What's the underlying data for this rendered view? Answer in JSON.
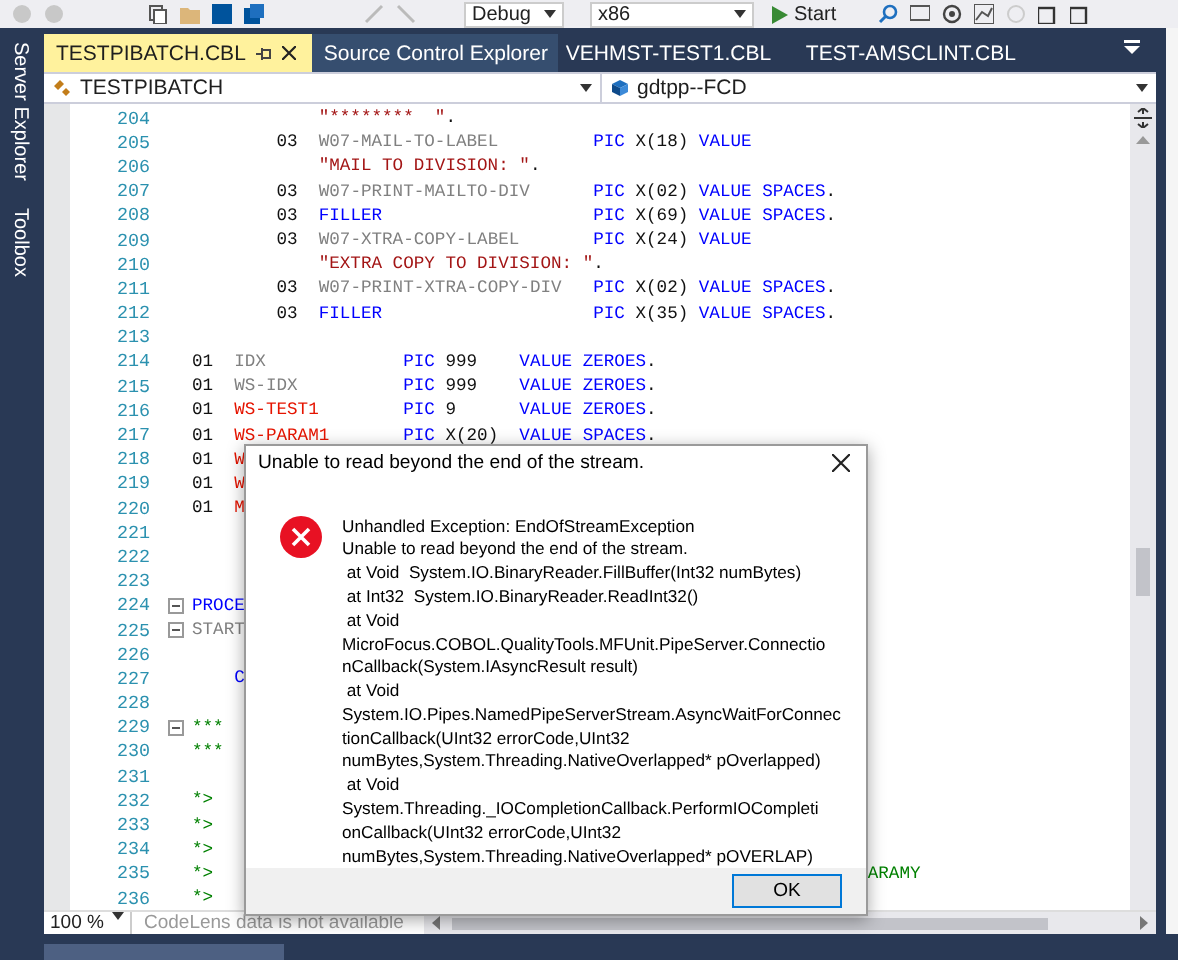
{
  "toolbar": {
    "configuration": "Debug",
    "platform": "x86",
    "start_label": "Start"
  },
  "side_tabs": [
    {
      "label": "Server Explorer"
    },
    {
      "label": "Toolbox"
    }
  ],
  "tabs": [
    {
      "label": "TESTPIBATCH.CBL",
      "selected": true
    },
    {
      "label": "Source Control Explorer",
      "selected": false
    },
    {
      "label": "VEHMST-TEST1.CBL",
      "selected": false
    },
    {
      "label": "TEST-AMSCLINT.CBL",
      "selected": false
    }
  ],
  "nav": {
    "left": "TESTPIBATCH",
    "right": "gdtpp--FCD"
  },
  "editor": {
    "lines": [
      {
        "number": "204",
        "tokens": [
          {
            "kind": "string",
            "text": "            \"********  \""
          },
          {
            "kind": "plain",
            "text": "."
          }
        ]
      },
      {
        "number": "205",
        "tokens": [
          {
            "kind": "plain",
            "text": "        03  "
          },
          {
            "kind": "name",
            "text": "W07-MAIL-TO-LABEL         "
          },
          {
            "kind": "keyword",
            "text": "PIC"
          },
          {
            "kind": "plain",
            "text": " X(18) "
          },
          {
            "kind": "keyword",
            "text": "VALUE"
          }
        ]
      },
      {
        "number": "206",
        "tokens": [
          {
            "kind": "string",
            "text": "            \"MAIL TO DIVISION: \""
          },
          {
            "kind": "plain",
            "text": "."
          }
        ]
      },
      {
        "number": "207",
        "tokens": [
          {
            "kind": "plain",
            "text": "        03  "
          },
          {
            "kind": "name",
            "text": "W07-PRINT-MAILTO-DIV      "
          },
          {
            "kind": "keyword",
            "text": "PIC"
          },
          {
            "kind": "plain",
            "text": " X(02) "
          },
          {
            "kind": "keyword",
            "text": "VALUE SPACES"
          },
          {
            "kind": "plain",
            "text": "."
          }
        ]
      },
      {
        "number": "208",
        "tokens": [
          {
            "kind": "plain",
            "text": "        03  "
          },
          {
            "kind": "keyword",
            "text": "FILLER                    PIC"
          },
          {
            "kind": "plain",
            "text": " X(69) "
          },
          {
            "kind": "keyword",
            "text": "VALUE SPACES"
          },
          {
            "kind": "plain",
            "text": "."
          }
        ]
      },
      {
        "number": "209",
        "tokens": [
          {
            "kind": "plain",
            "text": "        03  "
          },
          {
            "kind": "name",
            "text": "W07-XTRA-COPY-LABEL       "
          },
          {
            "kind": "keyword",
            "text": "PIC"
          },
          {
            "kind": "plain",
            "text": " X(24) "
          },
          {
            "kind": "keyword",
            "text": "VALUE"
          }
        ]
      },
      {
        "number": "210",
        "tokens": [
          {
            "kind": "string",
            "text": "            \"EXTRA COPY TO DIVISION: \""
          },
          {
            "kind": "plain",
            "text": "."
          }
        ]
      },
      {
        "number": "211",
        "tokens": [
          {
            "kind": "plain",
            "text": "        03  "
          },
          {
            "kind": "name",
            "text": "W07-PRINT-XTRA-COPY-DIV   "
          },
          {
            "kind": "keyword",
            "text": "PIC"
          },
          {
            "kind": "plain",
            "text": " X(02) "
          },
          {
            "kind": "keyword",
            "text": "VALUE SPACES"
          },
          {
            "kind": "plain",
            "text": "."
          }
        ]
      },
      {
        "number": "212",
        "tokens": [
          {
            "kind": "plain",
            "text": "        03  "
          },
          {
            "kind": "keyword",
            "text": "FILLER                    PIC"
          },
          {
            "kind": "plain",
            "text": " X(35) "
          },
          {
            "kind": "keyword",
            "text": "VALUE SPACES"
          },
          {
            "kind": "plain",
            "text": "."
          }
        ]
      },
      {
        "number": "213"
      },
      {
        "number": "214",
        "tokens": [
          {
            "kind": "plain",
            "text": "01  "
          },
          {
            "kind": "name",
            "text": "IDX             "
          },
          {
            "kind": "keyword",
            "text": "PIC"
          },
          {
            "kind": "plain",
            "text": " 999    "
          },
          {
            "kind": "keyword",
            "text": "VALUE ZEROES"
          },
          {
            "kind": "plain",
            "text": "."
          }
        ]
      },
      {
        "number": "215",
        "tokens": [
          {
            "kind": "plain",
            "text": "01  "
          },
          {
            "kind": "name",
            "text": "WS-IDX          "
          },
          {
            "kind": "keyword",
            "text": "PIC"
          },
          {
            "kind": "plain",
            "text": " 999    "
          },
          {
            "kind": "keyword",
            "text": "VALUE ZEROES"
          },
          {
            "kind": "plain",
            "text": "."
          }
        ]
      },
      {
        "number": "216",
        "tokens": [
          {
            "kind": "plain",
            "text": "01  "
          },
          {
            "kind": "var",
            "text": "WS-TEST1        "
          },
          {
            "kind": "keyword",
            "text": "PIC"
          },
          {
            "kind": "plain",
            "text": " 9      "
          },
          {
            "kind": "keyword",
            "text": "VALUE ZEROES"
          },
          {
            "kind": "plain",
            "text": "."
          }
        ]
      },
      {
        "number": "217",
        "tokens": [
          {
            "kind": "plain",
            "text": "01  "
          },
          {
            "kind": "var",
            "text": "WS-PARAM1       "
          },
          {
            "kind": "keyword",
            "text": "PIC"
          },
          {
            "kind": "plain",
            "text": " X(20)  "
          },
          {
            "kind": "keyword",
            "text": "VALUE SPACES"
          },
          {
            "kind": "plain",
            "text": "."
          }
        ]
      },
      {
        "number": "218",
        "tokens": [
          {
            "kind": "plain",
            "text": "01  "
          },
          {
            "kind": "var",
            "text": "W"
          }
        ]
      },
      {
        "number": "219",
        "tokens": [
          {
            "kind": "plain",
            "text": "01  "
          },
          {
            "kind": "var",
            "text": "W"
          }
        ]
      },
      {
        "number": "220",
        "tokens": [
          {
            "kind": "plain",
            "text": "01  "
          },
          {
            "kind": "var",
            "text": "M"
          }
        ]
      },
      {
        "number": "221"
      },
      {
        "number": "222"
      },
      {
        "number": "223"
      },
      {
        "number": "224",
        "fold": true,
        "tokens": [
          {
            "kind": "keyword",
            "text": "PROCE"
          }
        ]
      },
      {
        "number": "225",
        "fold": true,
        "tokens": [
          {
            "kind": "name",
            "text": "START"
          }
        ]
      },
      {
        "number": "226"
      },
      {
        "number": "227",
        "tokens": [
          {
            "kind": "keyword",
            "text": "    C"
          }
        ]
      },
      {
        "number": "228"
      },
      {
        "number": "229",
        "fold": true,
        "tokens": [
          {
            "kind": "comment",
            "text": "***"
          }
        ]
      },
      {
        "number": "230",
        "tokens": [
          {
            "kind": "comment",
            "text": "***"
          }
        ]
      },
      {
        "number": "231"
      },
      {
        "number": "232",
        "tokens": [
          {
            "kind": "comment",
            "text": "*>"
          }
        ]
      },
      {
        "number": "233",
        "tokens": [
          {
            "kind": "comment",
            "text": "*>"
          }
        ]
      },
      {
        "number": "234",
        "tokens": [
          {
            "kind": "comment",
            "text": "*>"
          }
        ]
      },
      {
        "number": "235",
        "tokens": [
          {
            "kind": "comment",
            "text": "*>"
          },
          {
            "kind": "comment",
            "text": "                                                              ARAMY"
          }
        ]
      },
      {
        "number": "236",
        "tokens": [
          {
            "kind": "comment",
            "text": "*>"
          }
        ]
      }
    ]
  },
  "status": {
    "zoom": "100 %",
    "codelens": "CodeLens data is not available"
  },
  "dialog": {
    "title": "Unable to read beyond the end of the stream.",
    "message_lines": [
      "Unhandled Exception: EndOfStreamException",
      "Unable to read beyond the end of the stream.",
      " at Void  System.IO.BinaryReader.FillBuffer(Int32 numBytes)",
      " at Int32  System.IO.BinaryReader.ReadInt32()",
      " at Void",
      "MicroFocus.COBOL.QualityTools.MFUnit.PipeServer.Connectio",
      "nCallback(System.IAsyncResult result)",
      " at Void",
      "System.IO.Pipes.NamedPipeServerStream.AsyncWaitForConnec",
      "tionCallback(UInt32 errorCode,UInt32",
      "numBytes,System.Threading.NativeOverlapped* pOverlapped)",
      " at Void",
      "System.Threading._IOCompletionCallback.PerformIOCompleti",
      "onCallback(UInt32 errorCode,UInt32",
      "numBytes,System.Threading.NativeOverlapped* pOVERLAP)"
    ],
    "button": "OK"
  }
}
